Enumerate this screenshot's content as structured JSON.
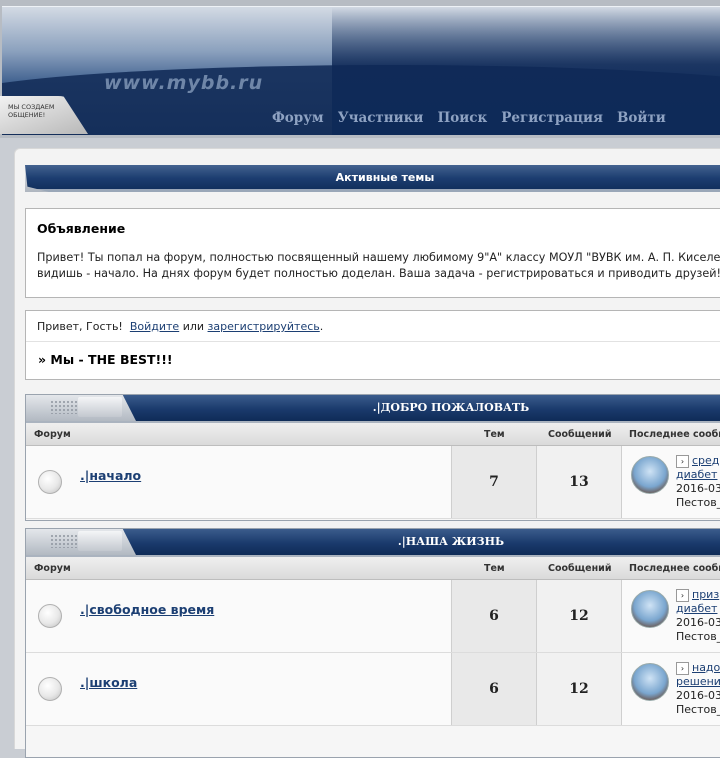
{
  "header": {
    "logo_text": "www.mybb.ru",
    "badge_text": "МЫ СОЗДАЕМ ОБЩЕНИЕ!",
    "nav": [
      "Форум",
      "Участники",
      "Поиск",
      "Регистрация",
      "Войти"
    ]
  },
  "active_topics": "Активные темы",
  "announcement": {
    "title": "Объявление",
    "line1": "Привет! Ты попал на форум, полностью посвященный нашему любимому 9\"А\" классу МОУЛ \"ВУВК им. А. П. Киселева",
    "line2": "видишь - начало. На днях форум будет полностью доделан. Ваша задача - регистрироваться и приводить друзей!"
  },
  "greeting": {
    "prefix": "Привет, Гость!",
    "login": "Войдите",
    "or": "или",
    "register": "зарегистрируйтесь",
    "suffix": ".",
    "motto": "» Мы - THE BEST!!!"
  },
  "columns": {
    "forum": "Форум",
    "topics": "Тем",
    "posts": "Сообщений",
    "last": "Последнее сообщ"
  },
  "categories": [
    {
      "title": ".|ДОБРО ПОЖАЛОВАТЬ",
      "forums": [
        {
          "name": ".|начало",
          "topics": "7",
          "posts": "13",
          "last_link1": "сред",
          "last_link2": "диабет",
          "last_date": "2016-03",
          "last_author": "Пестов_"
        }
      ]
    },
    {
      "title": ".|НАША ЖИЗНЬ",
      "forums": [
        {
          "name": ".|свободное время",
          "topics": "6",
          "posts": "12",
          "last_link1": "приз",
          "last_link2": "диабет",
          "last_date": "2016-03",
          "last_author": "Пестов_"
        },
        {
          "name": ".|школа",
          "topics": "6",
          "posts": "12",
          "last_link1": "надо",
          "last_link2": "решени",
          "last_date": "2016-03",
          "last_author": "Пестов_"
        }
      ]
    }
  ]
}
